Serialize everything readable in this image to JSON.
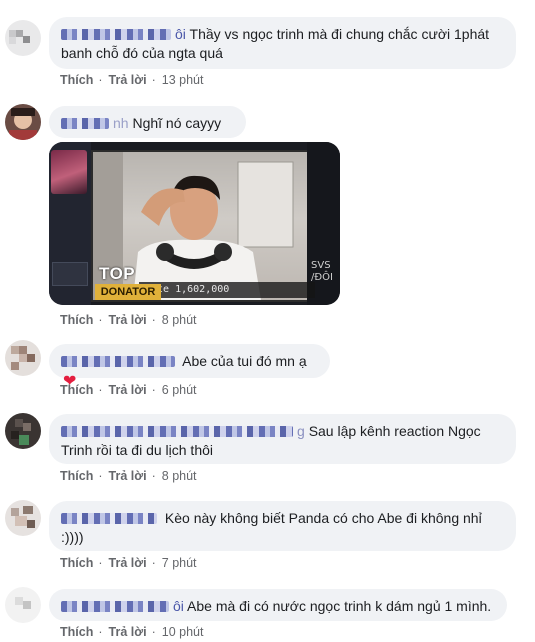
{
  "comments": [
    {
      "text": "Thầy vs ngọc trinh mà đi chung chắc cười 1phát banh chỗ đó của ngta quá",
      "name_fragment": "ôi",
      "actions": {
        "like": "Thích",
        "reply": "Trả lời",
        "time": "13 phút"
      }
    },
    {
      "text": "Nghĩ nó cayyy",
      "name_fragment": "nh",
      "actions": {
        "like": "Thích",
        "reply": "Trả lời",
        "time": "8 phút"
      },
      "media": {
        "top_label": "TOP",
        "donator_label": "DONATOR",
        "donate_text": "nate 1,602,000",
        "side_text_1": "SVS",
        "side_text_2": "/ĐÔI"
      }
    },
    {
      "text": "Abe của tui đó mn ạ",
      "reaction_icon": "heart-icon",
      "actions": {
        "like": "Thích",
        "reply": "Trả lời",
        "time": "6 phút"
      }
    },
    {
      "text_line1": "Sau lập kênh reaction Ngọc",
      "text_line2": "Trinh rồi ta đi du lịch thôi",
      "name_fragment": "g",
      "actions": {
        "like": "Thích",
        "reply": "Trả lời",
        "time": "8 phút"
      }
    },
    {
      "text_line1": "Kèo này không biết Panda có cho Abe đi không nhỉ",
      "text_line2": ":))))",
      "actions": {
        "like": "Thích",
        "reply": "Trả lời",
        "time": "7 phút"
      }
    },
    {
      "text": "Abe mà đi có nước ngọc trinh k dám ngủ 1 mình.",
      "name_fragment": "ôi",
      "actions": {
        "like": "Thích",
        "reply": "Trả lời",
        "time": "10 phút"
      }
    }
  ],
  "colors": {
    "bubble": "#f0f2f5",
    "meta_text": "#65676b",
    "heart": "#e41e3f"
  }
}
